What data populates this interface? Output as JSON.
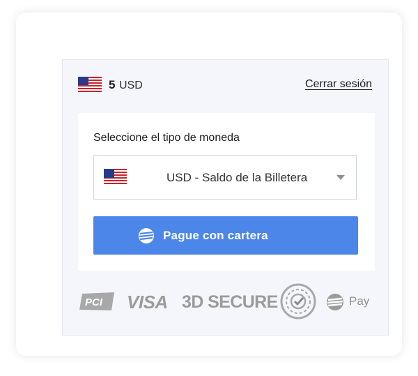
{
  "header": {
    "balance_amount": "5",
    "balance_currency": "USD",
    "logout_label": "Cerrar sesión"
  },
  "wallet": {
    "select_label": "Seleccione el tipo de moneda",
    "selected_currency": "USD - Saldo de la Billetera",
    "pay_button_label": "Pague con cartera"
  },
  "badges": {
    "pci": "PCI",
    "visa": "VISA",
    "secure": "3D SECURE",
    "pay": "Pay"
  },
  "colors": {
    "accent": "#4c86e8",
    "badge_gray": "#9b9b9b"
  },
  "icons": {
    "flag": "us-flag-icon",
    "pay_brand": "wallet-logo-icon",
    "dropdown": "chevron-down-icon"
  }
}
